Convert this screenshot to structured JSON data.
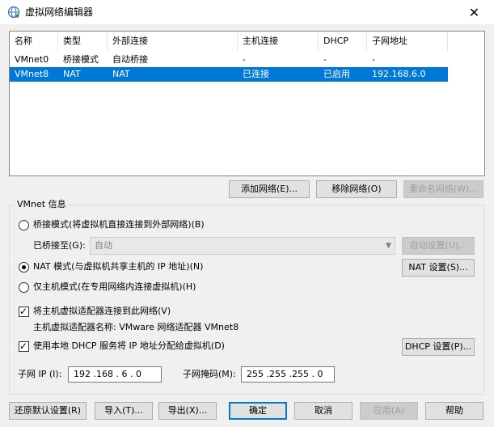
{
  "window": {
    "title": "虚拟网络编辑器",
    "close": "✕"
  },
  "list": {
    "columns": [
      "名称",
      "类型",
      "外部连接",
      "主机连接",
      "DHCP",
      "子网地址"
    ],
    "rows": [
      {
        "name": "VMnet0",
        "type": "桥接模式",
        "external": "自动桥接",
        "host": "-",
        "dhcp": "-",
        "subnet": "-"
      },
      {
        "name": "VMnet8",
        "type": "NAT",
        "external": "NAT",
        "host": "已连接",
        "dhcp": "已启用",
        "subnet": "192.168.6.0"
      }
    ],
    "selected_row": 1
  },
  "list_buttons": {
    "add": "添加网络(E)...",
    "remove": "移除网络(O)",
    "rename": "重命名网络(W)..."
  },
  "vmnet_info": {
    "group_label": "VMnet 信息",
    "bridge_mode": "桥接模式(将虚拟机直接连接到外部网络)(B)",
    "bridged_to_label": "已桥接至(G):",
    "bridged_to_value": "自动",
    "auto_settings": "自动设置(U)...",
    "nat_mode": "NAT 模式(与虚拟机共享主机的 IP 地址)(N)",
    "nat_settings": "NAT 设置(S)...",
    "host_only": "仅主机模式(在专用网络内连接虚拟机)(H)",
    "connect_adapter": "将主机虚拟适配器连接到此网络(V)",
    "adapter_name": "主机虚拟适配器名称: VMware 网络适配器 VMnet8",
    "use_dhcp": "使用本地 DHCP 服务将 IP 地址分配给虚拟机(D)",
    "dhcp_settings": "DHCP 设置(P)...",
    "subnet_ip_label": "子网 IP (I):",
    "subnet_ip": "192 .168 . 6 . 0",
    "subnet_mask_label": "子网掩码(M):",
    "subnet_mask": "255 .255 .255 . 0"
  },
  "footer": {
    "restore": "还原默认设置(R)",
    "import": "导入(T)...",
    "export": "导出(X)...",
    "ok": "确定",
    "cancel": "取消",
    "apply": "应用(A)",
    "help": "帮助"
  },
  "state": {
    "mode": "nat",
    "connect_adapter_checked": true,
    "use_dhcp_checked": true
  }
}
